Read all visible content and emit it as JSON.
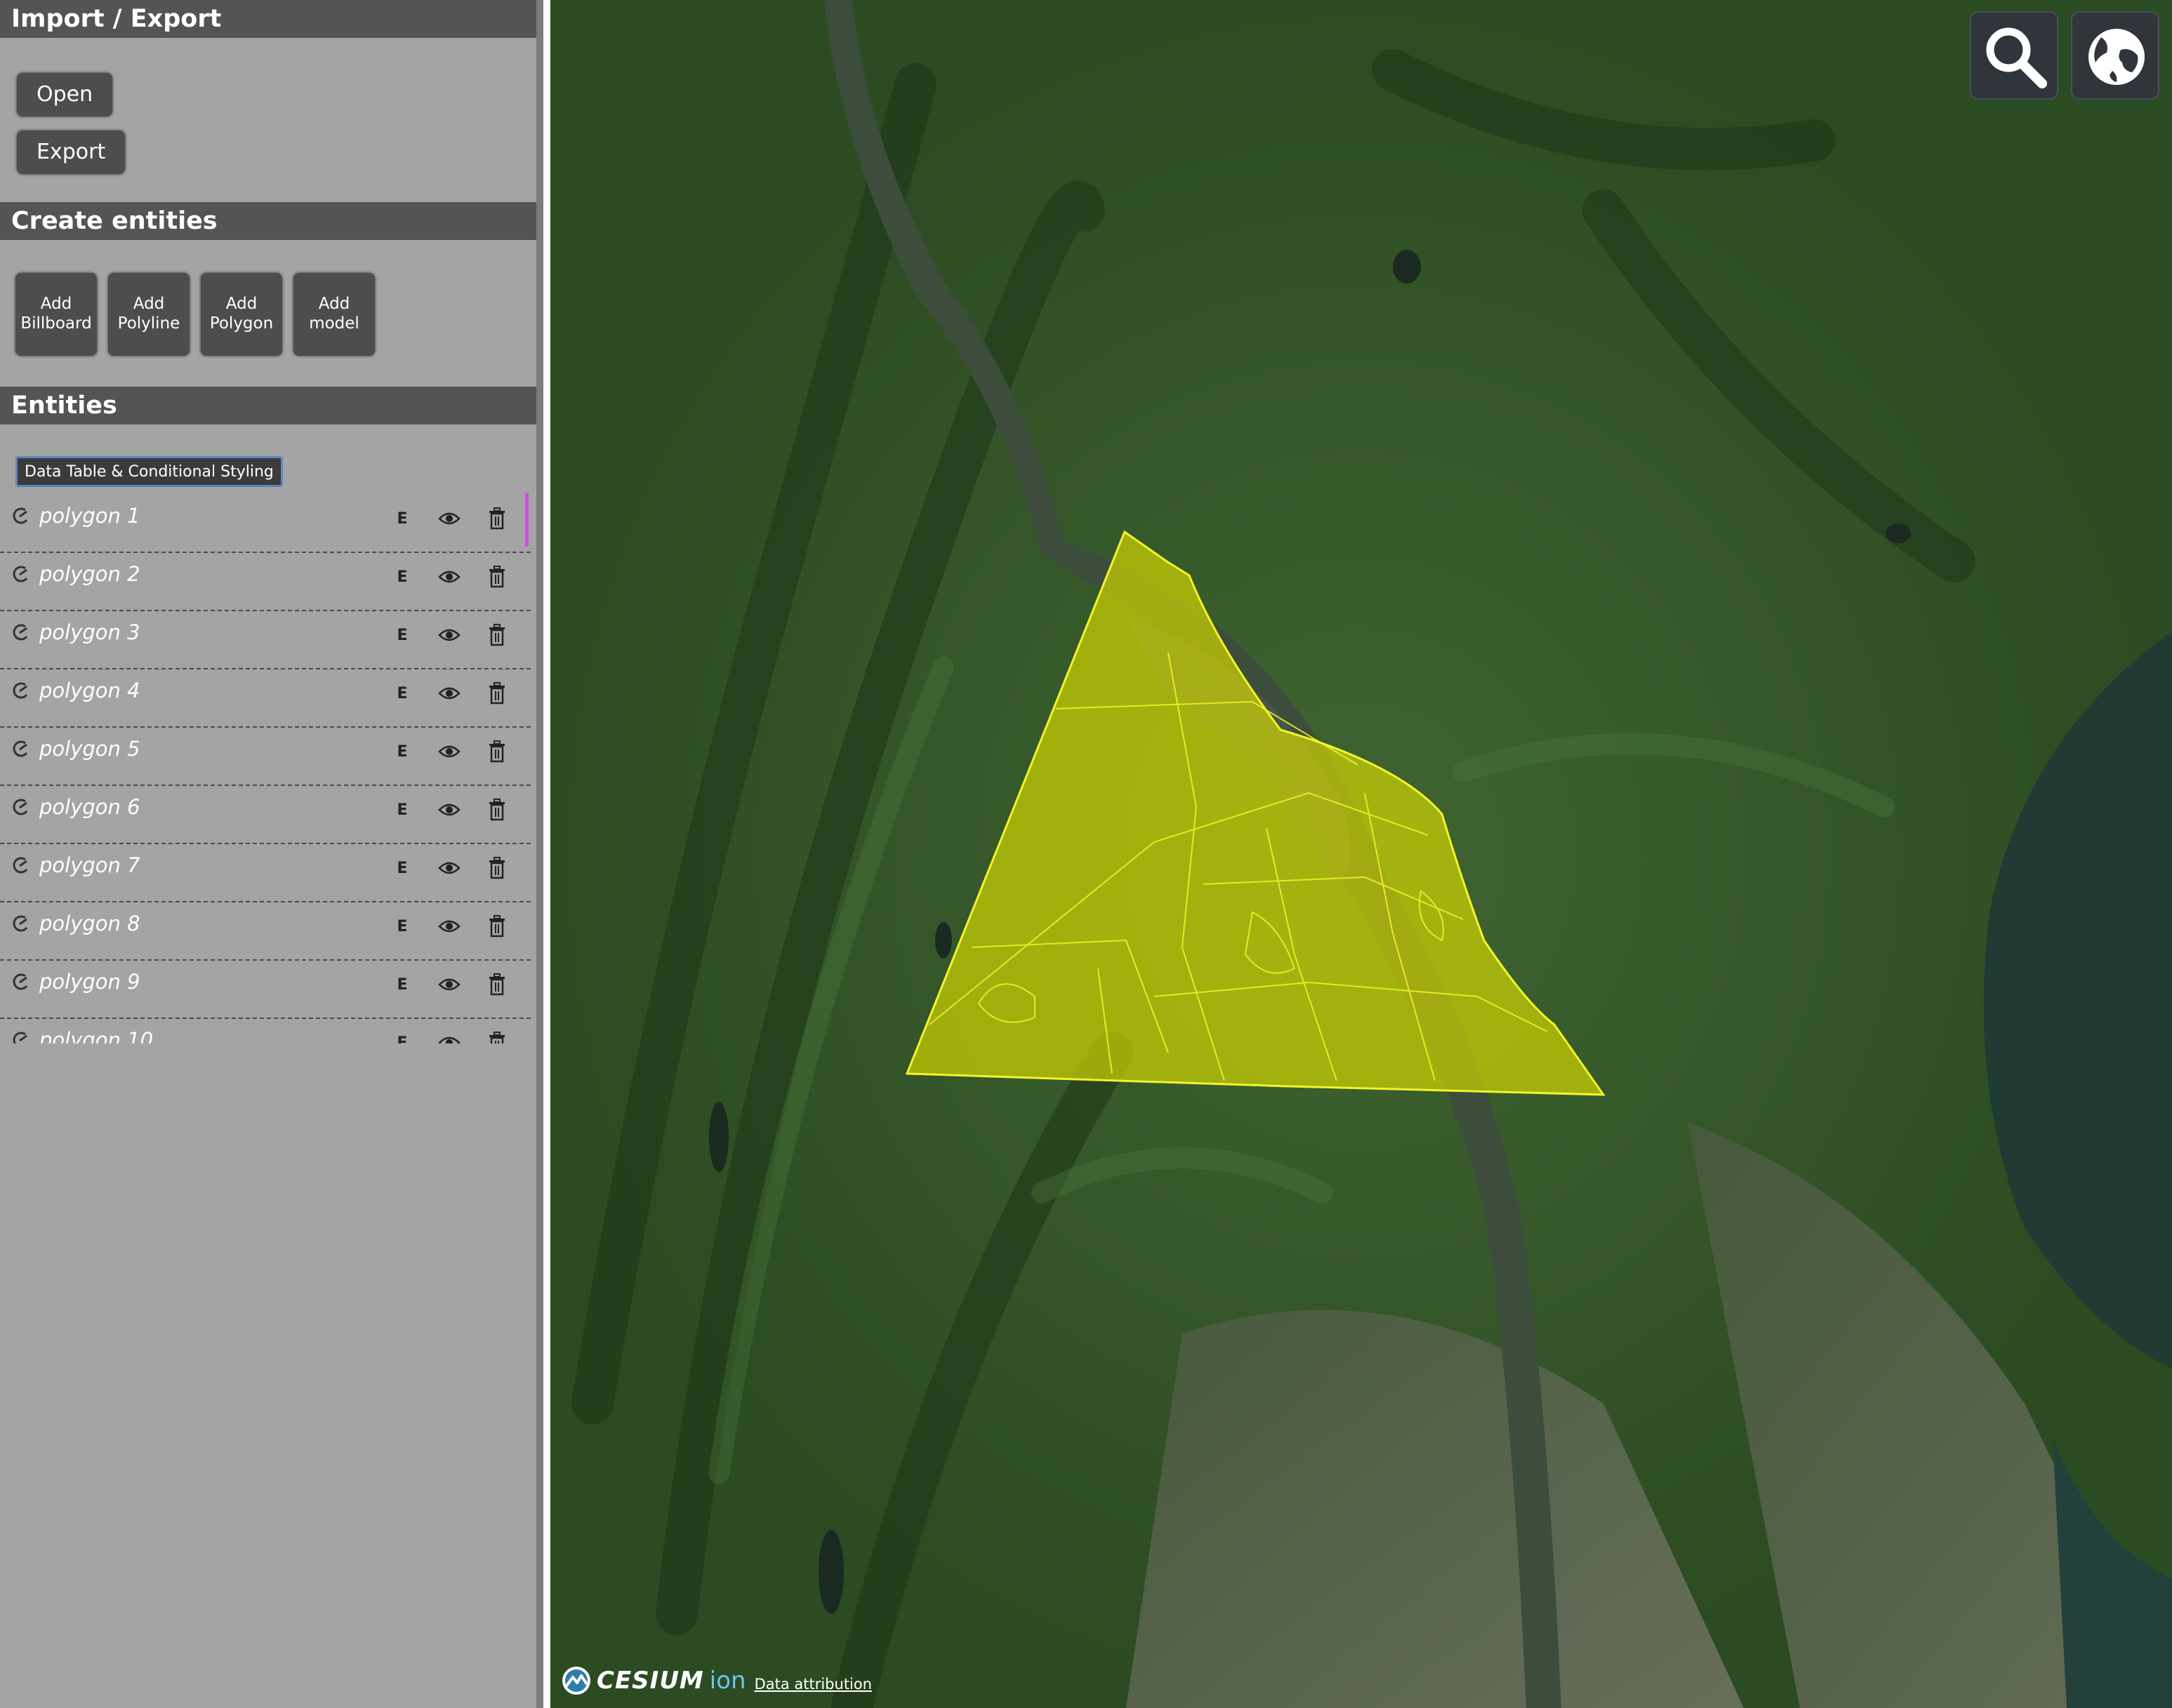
{
  "sidebar": {
    "import_export": {
      "title": "Import / Export",
      "open_label": "Open",
      "export_label": "Export"
    },
    "create_entities": {
      "title": "Create entities",
      "buttons": [
        {
          "line1": "Add",
          "line2": "Billboard"
        },
        {
          "line1": "Add",
          "line2": "Polyline"
        },
        {
          "line1": "Add",
          "line2": "Polygon"
        },
        {
          "line1": "Add",
          "line2": "model"
        }
      ]
    },
    "entities": {
      "title": "Entities",
      "data_table_label": "Data Table & Conditional Styling",
      "items": [
        {
          "name": "polygon 1",
          "edit": "E"
        },
        {
          "name": "polygon 2",
          "edit": "E"
        },
        {
          "name": "polygon 3",
          "edit": "E"
        },
        {
          "name": "polygon 4",
          "edit": "E"
        },
        {
          "name": "polygon 5",
          "edit": "E"
        },
        {
          "name": "polygon 6",
          "edit": "E"
        },
        {
          "name": "polygon 7",
          "edit": "E"
        },
        {
          "name": "polygon 8",
          "edit": "E"
        },
        {
          "name": "polygon 9",
          "edit": "E"
        },
        {
          "name": "polygon 10",
          "edit": "E"
        }
      ],
      "item_icon": "polygon-icon",
      "visibility_icon": "eye-icon",
      "delete_icon": "trash-icon"
    }
  },
  "map": {
    "toolbar": {
      "search_icon": "search-icon",
      "globe_icon": "globe-icon"
    },
    "polygon_fill_color": "#d4d900",
    "polygon_outline_color": "#f2f52a",
    "credits": {
      "brand": "CESIUM",
      "brand_suffix": "ion",
      "attribution_label": "Data attribution"
    }
  },
  "colors": {
    "panel_background": "#a4a4a4",
    "section_header": "#545454",
    "button": "#4d4d4d",
    "scroll_accent": "#c84fd8"
  }
}
